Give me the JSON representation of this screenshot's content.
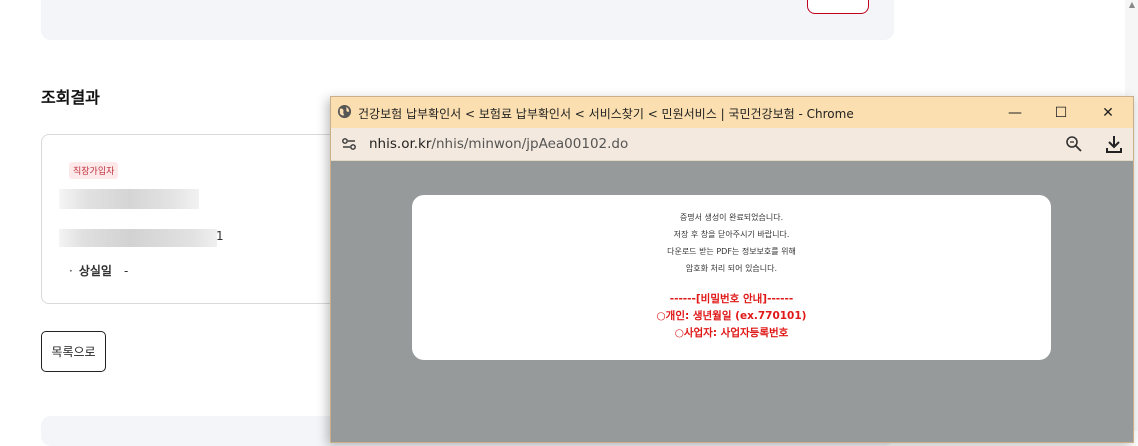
{
  "page": {
    "results_title": "조회결과",
    "card": {
      "badge": "직장가입자",
      "masked_suffix": "1",
      "loss_bullet": "·",
      "loss_label": "상실일",
      "loss_value": "-"
    },
    "back_button": "목록으로"
  },
  "popup": {
    "window_title": "건강보험 납부확인서 < 보험료 납부확인서 < 서비스찾기 < 민원서비스 | 국민건강보험 - Chrome",
    "url_host": "nhis.or.kr",
    "url_path": "/nhis/minwon/jpAea00102.do",
    "controls": {
      "minimize": "—",
      "maximize": "☐",
      "close": "✕"
    },
    "message": {
      "line1": "증명서 생성이 완료되었습니다.",
      "line2": "저장 후 창을 닫아주시기 바랍니다.",
      "line3": "다운로드 받는 PDF는 정보보호를 위해",
      "line4": "암호화 처리 되어 있습니다."
    },
    "password_notice": {
      "header": "------[비밀번호 안내]------",
      "personal": "○개인: 생년월일 (ex.770101)",
      "business": "○사업자: 사업자등록번호"
    }
  },
  "colors": {
    "titlebar_bg": "#fbdfb0",
    "content_bg": "#969a9a",
    "notice_red": "#e01818",
    "badge_red": "#c0303c"
  },
  "icons": {
    "title": "globe-icon",
    "site": "site-info-icon",
    "zoom": "zoom-icon",
    "download": "download-icon"
  }
}
